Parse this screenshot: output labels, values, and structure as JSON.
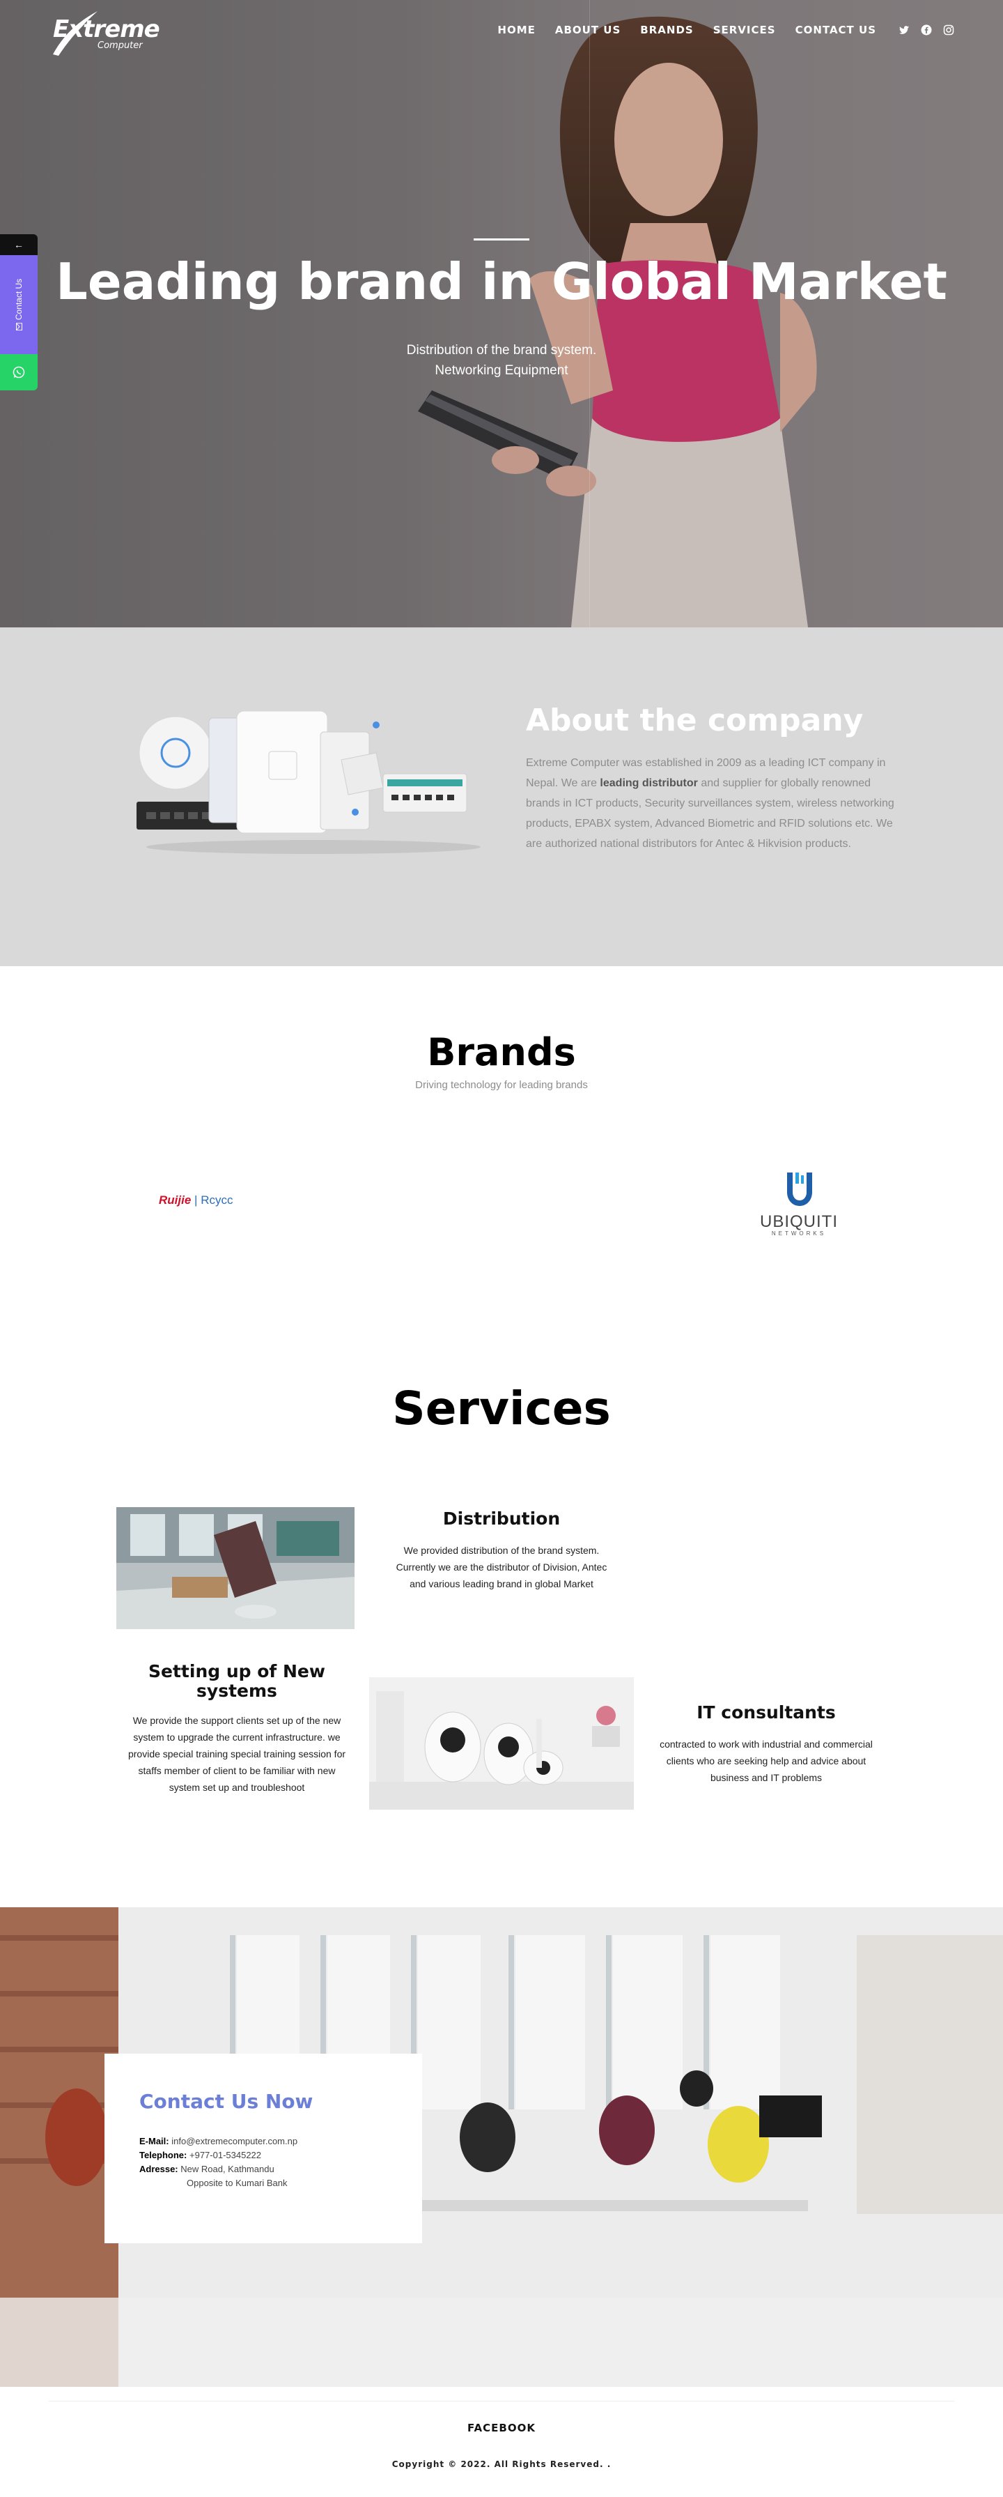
{
  "logo": {
    "main": "Extreme",
    "sub": "Computer"
  },
  "nav": {
    "items": [
      "HOME",
      "ABOUT US",
      "BRANDS",
      "SERVICES",
      "CONTACT US"
    ],
    "social_icons": [
      "twitter-icon",
      "facebook-icon",
      "instagram-icon"
    ]
  },
  "hero": {
    "title": "Leading brand in Global Market",
    "subtitle_line1": "Distribution of the brand system.",
    "subtitle_line2": "Networking Equipment"
  },
  "side_widget": {
    "arrow": "←",
    "contact_label": "Contact Us",
    "icons": [
      "arrow-left-icon",
      "mail-icon",
      "whatsapp-icon"
    ]
  },
  "about": {
    "title": "About the company",
    "text_part1": "Extreme Computer was established in 2009 as a leading ICT company in Nepal. We are ",
    "text_bold": "leading distributor",
    "text_part2": " and supplier for globally renowned brands in ICT products, Security surveillances system, wireless networking products, EPABX system, Advanced Biometric and RFID solutions etc. We are authorized national distributors for Antec & Hikvision products."
  },
  "brands": {
    "title": "Brands",
    "subtitle": "Driving technology for leading brands",
    "ruijie": {
      "name": "Ruijie",
      "sep": "|",
      "sub": "Rcycc"
    },
    "ubiquiti": {
      "name": "UBIQUITI",
      "sub": "NETWORKS"
    }
  },
  "services": {
    "title": "Services",
    "distribution": {
      "title": "Distribution",
      "text": "We provided distribution of the brand system. Currently we are the distributor of Division, Antec and various leading brand in global Market"
    },
    "setup": {
      "title_line1": "Setting up of New",
      "title_line2": "systems",
      "text": "We provide the support clients set up of the new system to upgrade the current infrastructure. we provide special training special training session for staffs member of client to be familiar with new system set up and troubleshoot"
    },
    "it": {
      "title": "IT consultants",
      "text": "contracted to work with industrial and commercial clients who are seeking help and advice about business and IT problems"
    }
  },
  "contact": {
    "title": "Contact Us Now",
    "email_label": "E-Mail:",
    "email": "info@extremecomputer.com.np",
    "phone_label": "Telephone:",
    "phone": "+977-01-5345222",
    "address_label": "Adresse:",
    "address1": "New Road, Kathmandu",
    "address2": "Opposite to Kumari Bank"
  },
  "footer": {
    "facebook": "FACEBOOK",
    "copyright": "Copyright © 2022. All Rights Reserved. ."
  },
  "colors": {
    "about_bg": "#d9d9d9",
    "contact_accent": "#6b7fd6",
    "widget_purple": "#7b68ee",
    "widget_green": "#25d366"
  }
}
